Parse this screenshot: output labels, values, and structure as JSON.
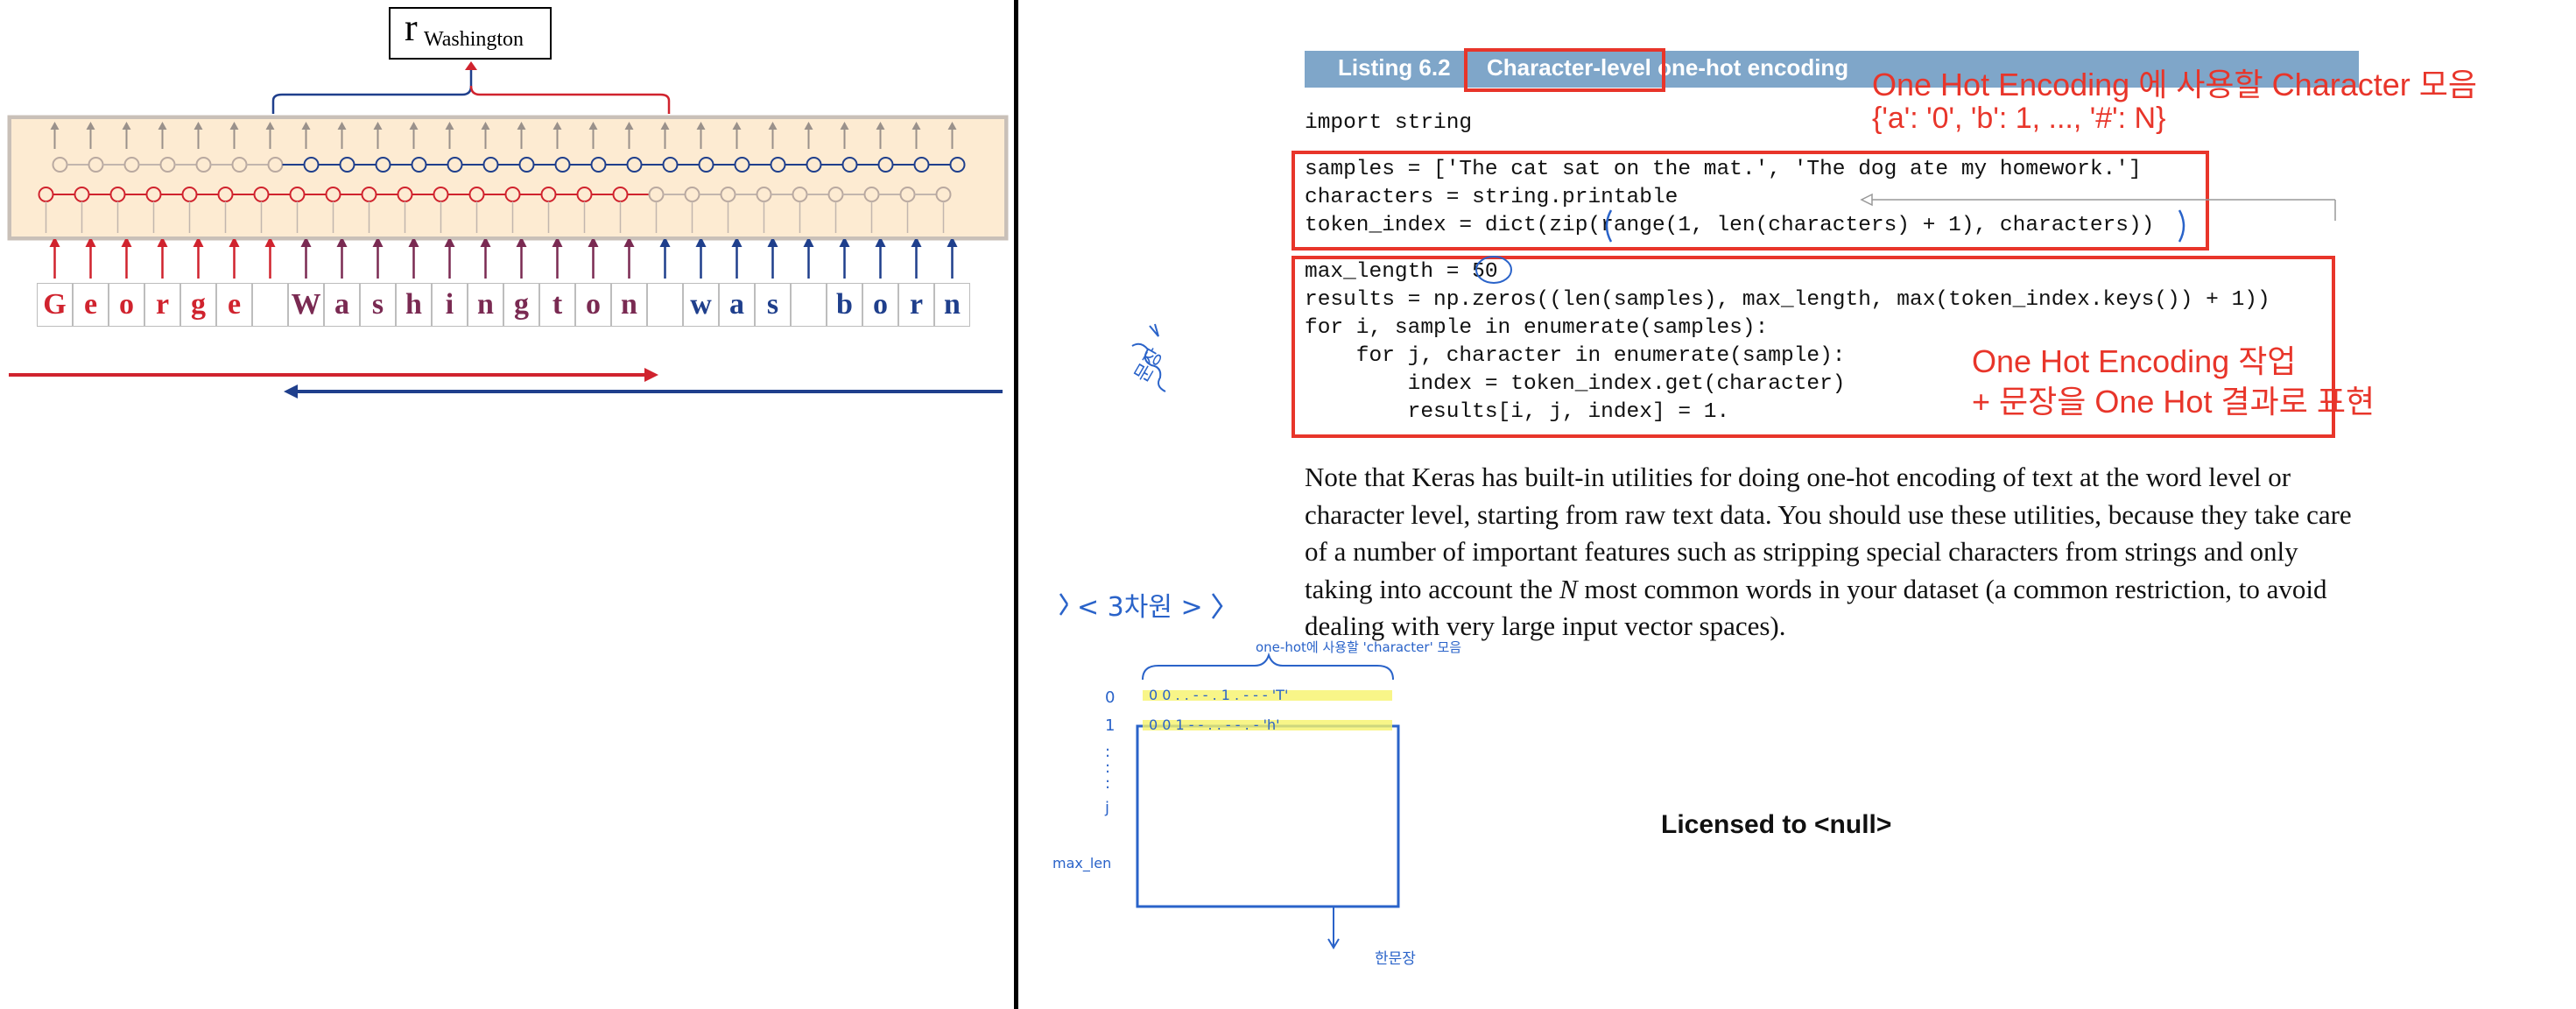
{
  "left_figure": {
    "r_symbol": "r",
    "r_subscript": "Washington",
    "letters": [
      {
        "ch": "G",
        "color": "#d0232e"
      },
      {
        "ch": "e",
        "color": "#d0232e"
      },
      {
        "ch": "o",
        "color": "#d0232e"
      },
      {
        "ch": "r",
        "color": "#d0232e"
      },
      {
        "ch": "g",
        "color": "#d0232e"
      },
      {
        "ch": "e",
        "color": "#d0232e"
      },
      {
        "ch": "",
        "color": "#d0232e"
      },
      {
        "ch": "W",
        "color": "#7a2a52"
      },
      {
        "ch": "a",
        "color": "#7a2a52"
      },
      {
        "ch": "s",
        "color": "#7a2a52"
      },
      {
        "ch": "h",
        "color": "#7a2a52"
      },
      {
        "ch": "i",
        "color": "#7a2a52"
      },
      {
        "ch": "n",
        "color": "#7a2a52"
      },
      {
        "ch": "g",
        "color": "#7a2a52"
      },
      {
        "ch": "t",
        "color": "#7a2a52"
      },
      {
        "ch": "o",
        "color": "#7a2a52"
      },
      {
        "ch": "n",
        "color": "#7a2a52"
      },
      {
        "ch": "",
        "color": "#1f3f8c"
      },
      {
        "ch": "w",
        "color": "#1f3f8c"
      },
      {
        "ch": "a",
        "color": "#1f3f8c"
      },
      {
        "ch": "s",
        "color": "#1f3f8c"
      },
      {
        "ch": "",
        "color": "#1f3f8c"
      },
      {
        "ch": "b",
        "color": "#1f3f8c"
      },
      {
        "ch": "o",
        "color": "#1f3f8c"
      },
      {
        "ch": "r",
        "color": "#1f3f8c"
      },
      {
        "ch": "n",
        "color": "#1f3f8c"
      }
    ],
    "forward_color": "#d0232e",
    "backward_color": "#1f3f8c"
  },
  "listing": {
    "label": "Listing 6.2",
    "title": "Character-level one-hot encoding"
  },
  "code": {
    "line1": "import string",
    "line2": "samples = ['The cat sat on the mat.', 'The dog ate my homework.']",
    "line3": "characters = string.printable",
    "line4": "token_index = dict(zip(range(1, len(characters) + 1), characters))",
    "line5": "max_length = 50",
    "line6": "results = np.zeros((len(samples), max_length, max(token_index.keys()) + 1))",
    "line7": "for i, sample in enumerate(samples):",
    "line8": "    for j, character in enumerate(sample):",
    "line9": "        index = token_index.get(character)",
    "line10": "        results[i, j, index] = 1."
  },
  "annotations": {
    "top_line1": "One Hot Encoding 에 사용할 Character 모음",
    "top_line2": "{'a': '0', 'b': 1, ..., '#': N}",
    "mid_line1": "One Hot Encoding 작업",
    "mid_line2": "+ 문장을 One Hot 결과로 표현"
  },
  "paragraph": {
    "before_n": "Note that Keras has built-in utilities for doing one-hot encoding of text at the word level or character level, starting from raw text data. You should use these utilities, because they take care of a number of important features such as stripping special characters from strings and only taking into account the ",
    "n": "N",
    "after_n": " most common words in your dataset (a common restriction, to avoid dealing with very large input vector spaces)."
  },
  "licensed": "Licensed to   <null>",
  "handwriting": {
    "three_dim": "< 3차원 >",
    "top_label": "one-hot에 사용할 'character' 모음",
    "row0": "0",
    "row1": "1",
    "row_j": "j",
    "row_max": "max_len",
    "row0_bits": "0 0  . . - - .  1  . - - -  'T'",
    "row1_bits": "0 0  1  - - . . - - . -   'h'",
    "bottom": "한문장",
    "side_scribble": "문장"
  },
  "colors": {
    "highlight_red": "#e8352a",
    "hand_blue": "#2a63c9",
    "listing_bar": "#7fa6c9",
    "marker_yellow": "#f6f36a"
  }
}
